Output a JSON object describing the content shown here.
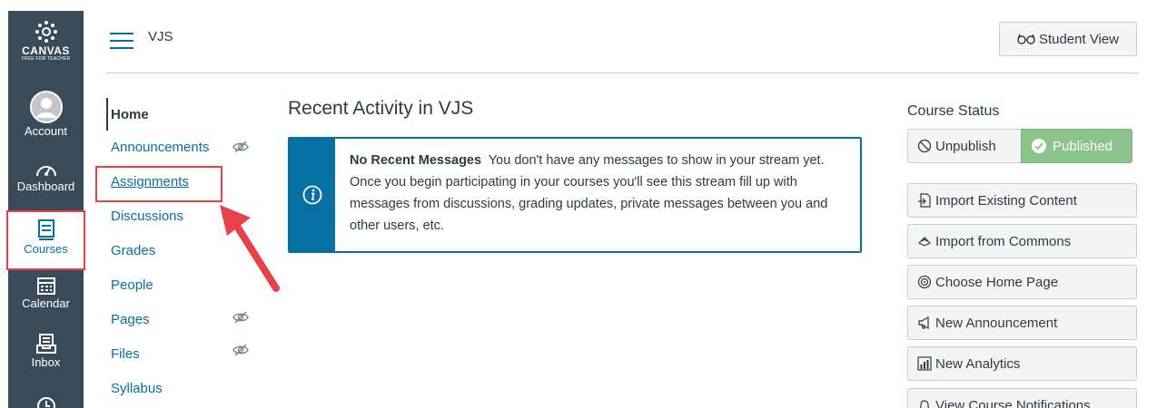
{
  "global_nav": {
    "logo_word": "CANVAS",
    "logo_sub": "FREE FOR TEACHER",
    "items": [
      {
        "label": "Account",
        "icon": "avatar-icon"
      },
      {
        "label": "Dashboard",
        "icon": "dashboard-icon"
      },
      {
        "label": "Courses",
        "icon": "courses-icon",
        "active": true
      },
      {
        "label": "Calendar",
        "icon": "calendar-icon"
      },
      {
        "label": "Inbox",
        "icon": "inbox-icon"
      },
      {
        "label": "",
        "icon": "history-icon"
      }
    ]
  },
  "header": {
    "breadcrumb": "VJS",
    "student_view_label": "Student View"
  },
  "course_nav": {
    "items": [
      {
        "label": "Home",
        "active": true
      },
      {
        "label": "Announcements",
        "hidden_icon": true
      },
      {
        "label": "Assignments",
        "highlighted": true
      },
      {
        "label": "Discussions"
      },
      {
        "label": "Grades"
      },
      {
        "label": "People"
      },
      {
        "label": "Pages",
        "hidden_icon": true
      },
      {
        "label": "Files",
        "hidden_icon": true
      },
      {
        "label": "Syllabus"
      }
    ]
  },
  "main": {
    "title": "Recent Activity in VJS",
    "alert_heading": "No Recent Messages",
    "alert_body": "You don't have any messages to show in your stream yet. Once you begin participating in your courses you'll see this stream fill up with messages from discussions, grading updates, private messages between you and other users, etc."
  },
  "sidebar": {
    "status_title": "Course Status",
    "unpublish_label": "Unpublish",
    "published_label": "Published",
    "buttons": [
      "Import Existing Content",
      "Import from Commons",
      "Choose Home Page",
      "New Announcement",
      "New Analytics",
      "View Course Notifications"
    ]
  },
  "colors": {
    "nav_bg": "#394b58",
    "link": "#0770a3",
    "published_green": "#8bc48c",
    "highlight_red": "#e8414a"
  }
}
